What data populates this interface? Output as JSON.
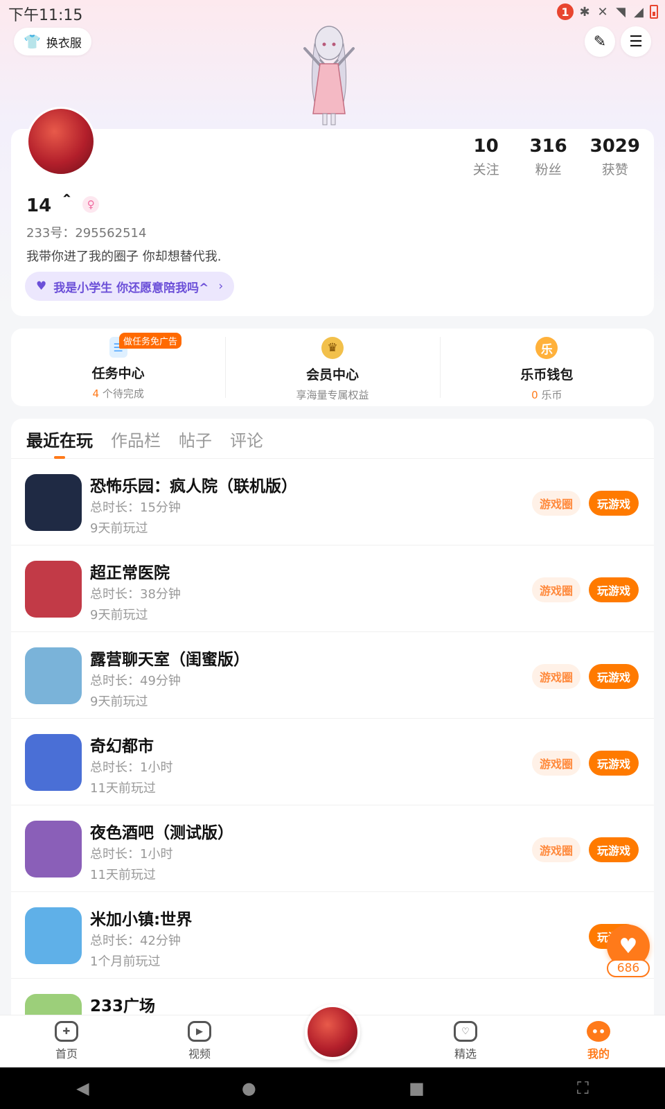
{
  "status_bar": {
    "time": "下午11:15",
    "notification_count": "1"
  },
  "header": {
    "outfit_label": "换衣服"
  },
  "profile": {
    "stats": [
      {
        "num": "10",
        "label": "关注"
      },
      {
        "num": "316",
        "label": "粉丝"
      },
      {
        "num": "3029",
        "label": "获赞"
      }
    ],
    "nickname": "14 ＾",
    "uid": "233号：295562514",
    "bio": "我带你进了我的圈子 你却想替代我.",
    "circle": "我是小学生 你还愿意陪我吗^"
  },
  "quick": {
    "task": {
      "tag": "做任务免广告",
      "title": "任务中心",
      "count": "4",
      "sub": " 个待完成"
    },
    "vip": {
      "title": "会员中心",
      "sub": "享海量专属权益"
    },
    "wallet": {
      "icon": "乐",
      "title": "乐币钱包",
      "count": "0",
      "sub": " 乐币"
    }
  },
  "tabs": [
    "最近在玩",
    "作品栏",
    "帖子",
    "评论"
  ],
  "games": [
    {
      "name": "恐怖乐园：疯人院（联机版）",
      "duration": "总时长：15分钟",
      "last": "9天前玩过",
      "icon_color": "#1f2a44"
    },
    {
      "name": "超正常医院",
      "duration": "总时长：38分钟",
      "last": "9天前玩过",
      "icon_color": "#c23a47"
    },
    {
      "name": "露营聊天室（闺蜜版）",
      "duration": "总时长：49分钟",
      "last": "9天前玩过",
      "icon_color": "#7ab3d9"
    },
    {
      "name": "奇幻都市",
      "duration": "总时长：1小时",
      "last": "11天前玩过",
      "icon_color": "#4a6fd6"
    },
    {
      "name": "夜色酒吧（测试版）",
      "duration": "总时长：1小时",
      "last": "11天前玩过",
      "icon_color": "#8a5fb8"
    },
    {
      "name": "米加小镇:世界",
      "duration": "总时长：42分钟",
      "last": "1个月前玩过",
      "icon_color": "#5fb0e8"
    },
    {
      "name": "233广场",
      "duration": "",
      "last": "",
      "icon_color": "#9ccf7a"
    }
  ],
  "buttons": {
    "circle": "游戏圈",
    "play": "玩游戏"
  },
  "float_like": {
    "count": "686"
  },
  "nav": {
    "home": "首页",
    "video": "视频",
    "featured": "精选",
    "mine": "我的"
  },
  "colors": {
    "accent": "#ff7a1a",
    "pill_bg": "#ece7fd",
    "pill_text": "#6b4fd8"
  }
}
